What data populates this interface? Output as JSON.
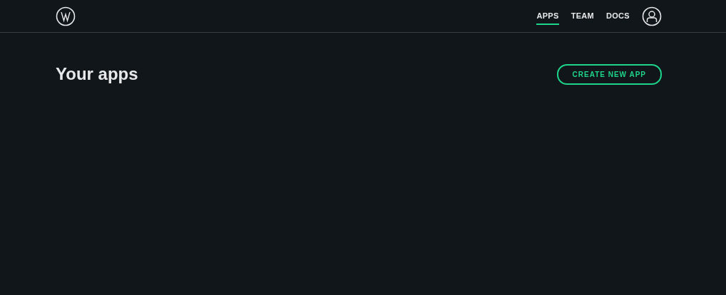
{
  "nav": {
    "items": [
      {
        "label": "APPS",
        "selected": true
      },
      {
        "label": "TEAM",
        "selected": false
      },
      {
        "label": "DOCS",
        "selected": false
      }
    ]
  },
  "page": {
    "title": "Your apps",
    "button": "CREATE NEW APP"
  }
}
